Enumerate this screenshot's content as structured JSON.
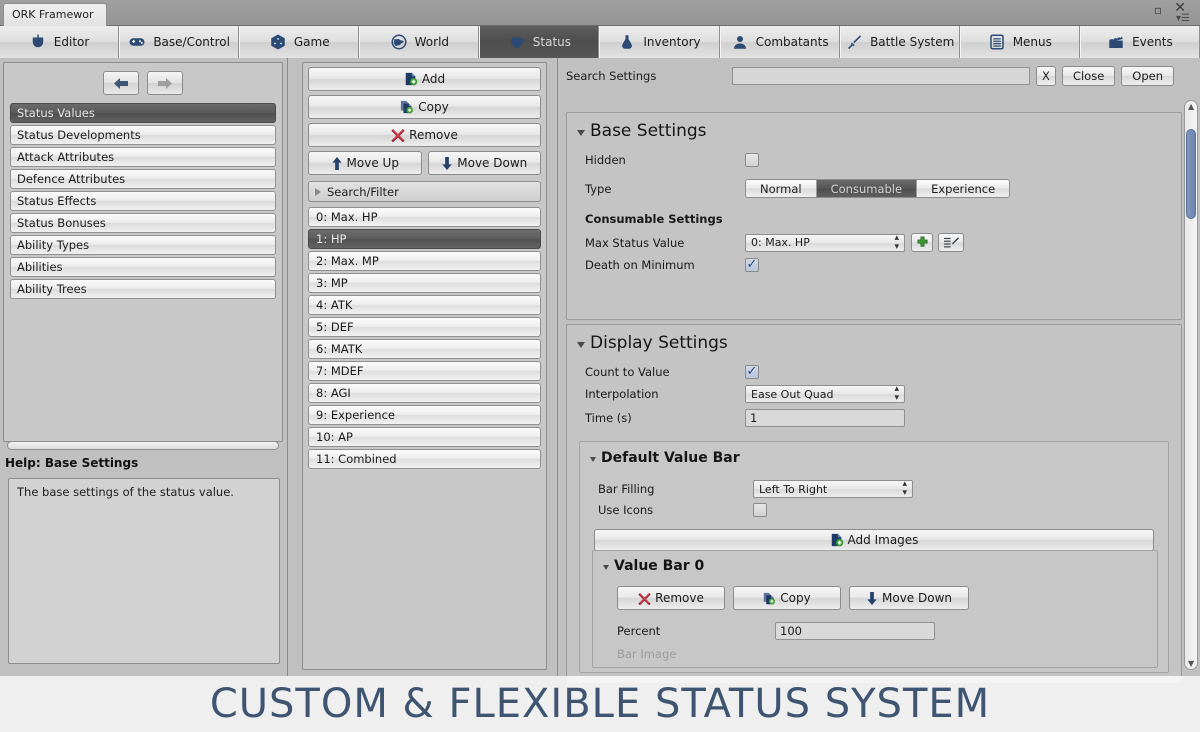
{
  "window": {
    "tab_title": "ORK Framewor",
    "minimize_icon": "minimize-icon",
    "close_icon": "close-icon",
    "menu_icon": "window-menu-icon"
  },
  "toolbar": {
    "tabs": [
      {
        "label": "Editor",
        "icon": "editor-icon",
        "active": false
      },
      {
        "label": "Base/Control",
        "icon": "gamepad-icon",
        "active": false
      },
      {
        "label": "Game",
        "icon": "dice-icon",
        "active": false
      },
      {
        "label": "World",
        "icon": "globe-icon",
        "active": false
      },
      {
        "label": "Status",
        "icon": "heart-icon",
        "active": true
      },
      {
        "label": "Inventory",
        "icon": "flask-icon",
        "active": false
      },
      {
        "label": "Combatants",
        "icon": "person-icon",
        "active": false
      },
      {
        "label": "Battle System",
        "icon": "sword-icon",
        "active": false
      },
      {
        "label": "Menus",
        "icon": "list-icon",
        "active": false
      },
      {
        "label": "Events",
        "icon": "clapperboard-icon",
        "active": false
      }
    ]
  },
  "sidebar": {
    "back_icon": "arrow-left-icon",
    "forward_icon": "arrow-right-icon",
    "items": [
      {
        "label": "Status Values",
        "selected": true
      },
      {
        "label": "Status Developments",
        "selected": false
      },
      {
        "label": "Attack Attributes",
        "selected": false
      },
      {
        "label": "Defence Attributes",
        "selected": false
      },
      {
        "label": "Status Effects",
        "selected": false
      },
      {
        "label": "Status Bonuses",
        "selected": false
      },
      {
        "label": "Ability Types",
        "selected": false
      },
      {
        "label": "Abilities",
        "selected": false
      },
      {
        "label": "Ability Trees",
        "selected": false
      }
    ],
    "help_title": "Help: Base Settings",
    "help_text": "The base settings of the status value."
  },
  "mid_panel": {
    "add_label": "Add",
    "add_icon": "add-document-icon",
    "copy_label": "Copy",
    "copy_icon": "copy-document-icon",
    "remove_label": "Remove",
    "remove_icon": "remove-x-icon",
    "move_up_label": "Move Up",
    "move_up_icon": "arrow-up-icon",
    "move_down_label": "Move Down",
    "move_down_icon": "arrow-down-icon",
    "search_filter_label": "Search/Filter",
    "search_filter_icon": "triangle-right-icon",
    "items": [
      {
        "label": "0: Max. HP",
        "selected": false
      },
      {
        "label": "1: HP",
        "selected": true
      },
      {
        "label": "2: Max. MP",
        "selected": false
      },
      {
        "label": "3: MP",
        "selected": false
      },
      {
        "label": "4: ATK",
        "selected": false
      },
      {
        "label": "5: DEF",
        "selected": false
      },
      {
        "label": "6: MATK",
        "selected": false
      },
      {
        "label": "7: MDEF",
        "selected": false
      },
      {
        "label": "8: AGI",
        "selected": false
      },
      {
        "label": "9: Experience",
        "selected": false
      },
      {
        "label": "10: AP",
        "selected": false
      },
      {
        "label": "11: Combined",
        "selected": false
      }
    ]
  },
  "search_settings": {
    "label": "Search Settings",
    "value": "",
    "placeholder": "",
    "clear_label": "X",
    "close_label": "Close",
    "open_label": "Open"
  },
  "base_settings": {
    "title": "Base Settings",
    "collapse_icon": "triangle-down-icon",
    "hidden_label": "Hidden",
    "hidden_checked": false,
    "type_label": "Type",
    "type_options": [
      "Normal",
      "Consumable",
      "Experience"
    ],
    "type_selected": "Consumable",
    "consumable_header": "Consumable Settings",
    "max_status_value_label": "Max Status Value",
    "max_status_value": "0: Max. HP",
    "add_icon": "plus-green-icon",
    "edit_icon": "list-edit-icon",
    "death_on_minimum_label": "Death on Minimum",
    "death_on_minimum_checked": true
  },
  "display_settings": {
    "title": "Display Settings",
    "collapse_icon": "triangle-down-icon",
    "count_to_value_label": "Count to Value",
    "count_to_value_checked": true,
    "interpolation_label": "Interpolation",
    "interpolation_value": "Ease Out Quad",
    "time_label": "Time (s)",
    "time_value": "1",
    "default_value_bar": {
      "title": "Default Value Bar",
      "collapse_icon": "triangle-down-icon",
      "bar_filling_label": "Bar Filling",
      "bar_filling_value": "Left To Right",
      "use_icons_label": "Use Icons",
      "use_icons_checked": false,
      "add_images_label": "Add Images",
      "add_images_icon": "add-document-icon",
      "value_bar": {
        "title": "Value Bar 0",
        "collapse_icon": "triangle-down-icon",
        "remove_label": "Remove",
        "remove_icon": "remove-x-icon",
        "copy_label": "Copy",
        "copy_icon": "copy-document-icon",
        "move_down_label": "Move Down",
        "move_down_icon": "arrow-down-icon",
        "percent_label": "Percent",
        "percent_value": "100",
        "bar_image_label": "Bar Image"
      }
    }
  },
  "banner": {
    "text": "CUSTOM & FLEXIBLE STATUS SYSTEM"
  },
  "colors": {
    "accent_blue": "#2b4a7e",
    "selected_dark": "#575757",
    "panel_bg": "#c0c0c0",
    "banner_text": "#3e5470"
  }
}
